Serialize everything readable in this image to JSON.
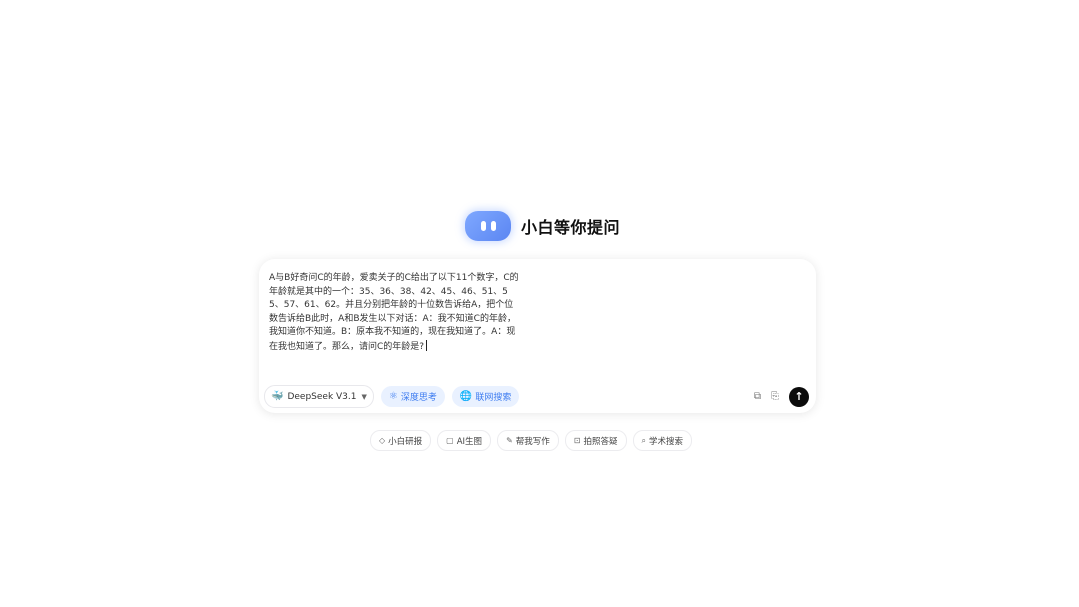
{
  "hero": {
    "title": "小白等你提问"
  },
  "input": {
    "text": "A与B好奇问C的年龄，爱卖关子的C给出了以下11个数字，C的年龄就是其中的一个：35、36、38、42、45、46、51、55、57、61、62。并且分别把年龄的十位数告诉给A，把个位数告诉给B此时，A和B发生以下对话：A：我不知道C的年龄，我知道你不知道。B：原本我不知道的，现在我知道了。A：现在我也知道了。那么，请问C的年龄是?"
  },
  "toolbar": {
    "model_label": "DeepSeek V3.1",
    "model_icon": "whale-icon",
    "deep_think_label": "深度思考",
    "web_search_label": "联网搜索"
  },
  "quick_actions": [
    {
      "label": "小白研报",
      "icon": "graduation-cap-icon"
    },
    {
      "label": "AI生图",
      "icon": "image-icon"
    },
    {
      "label": "帮我写作",
      "icon": "edit-icon"
    },
    {
      "label": "拍照答疑",
      "icon": "camera-icon"
    },
    {
      "label": "学术搜索",
      "icon": "book-search-icon"
    }
  ],
  "colors": {
    "accent": "#3d7cf0",
    "pill_bg": "#e9f1ff",
    "send_bg": "#0b0b0b",
    "logo": "#6b94f6"
  }
}
